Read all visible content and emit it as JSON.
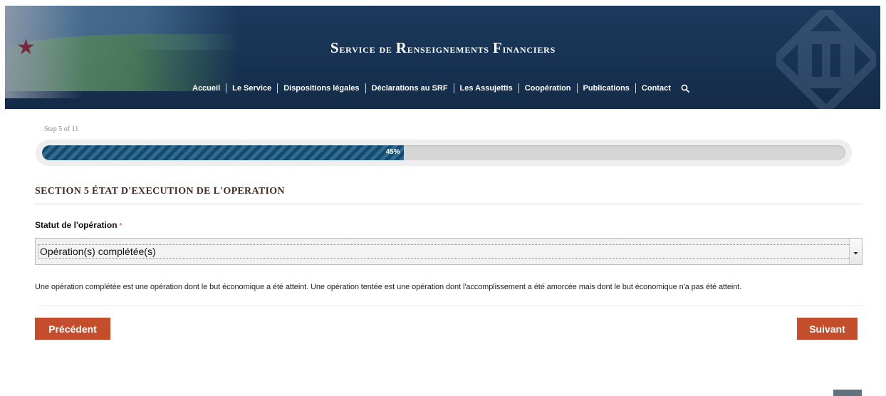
{
  "header": {
    "title_cap1": "S",
    "title_rest1": "ervice de ",
    "title_cap2": "R",
    "title_rest2": "enseignements ",
    "title_cap3": "F",
    "title_rest3": "inanciers",
    "colors": {
      "background": "#1a365a",
      "text": "#ffffff"
    }
  },
  "nav": {
    "items": [
      {
        "label": "Accueil"
      },
      {
        "label": "Le Service"
      },
      {
        "label": "Dispositions légales"
      },
      {
        "label": "Déclarations au SRF"
      },
      {
        "label": "Les Assujettis"
      },
      {
        "label": "Coopération"
      },
      {
        "label": "Publications"
      },
      {
        "label": "Contact"
      }
    ],
    "search_icon": "search-icon"
  },
  "progress": {
    "step_text": "Step 5 of 11",
    "percent_text": "45%",
    "percent_value": 45,
    "fill_color": "#0f4c73"
  },
  "section": {
    "title": "SECTION 5 ÉTAT D'EXECUTION DE L'OPERATION"
  },
  "field": {
    "label": "Statut de l'opération",
    "required_mark": "*",
    "selected_value": "Opération(s) complétée(s)",
    "arrow_icon": "chevron-down-icon",
    "help_text": "Une opération complétée est une opération dont le but économique a été atteint. Une opération tentée est une opération dont l'accomplissement a été amorcée mais dont le but économique n'a pas été atteint."
  },
  "buttons": {
    "prev_label": "Précédent",
    "next_label": "Suivant",
    "color": "#c44d2c"
  }
}
